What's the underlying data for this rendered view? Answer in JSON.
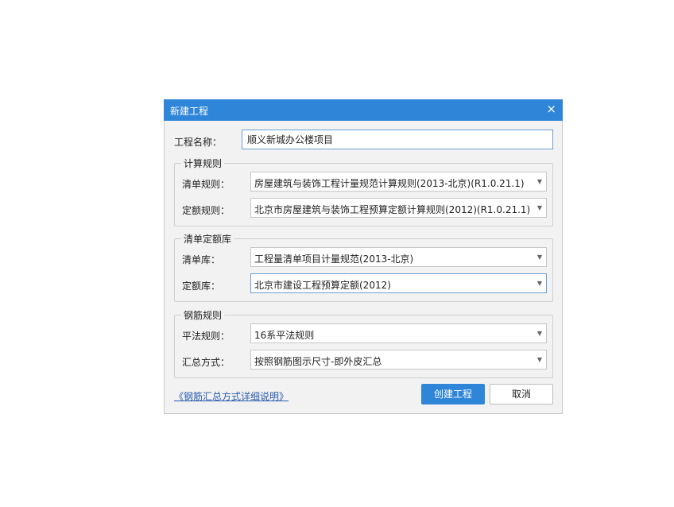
{
  "dialog": {
    "title": "新建工程",
    "close_icon": "×"
  },
  "project_name": {
    "label": "工程名称：",
    "value": "顺义新城办公楼项目"
  },
  "calc_rules": {
    "legend": "计算规则",
    "list_rule": {
      "label": "清单规则：",
      "value": "房屋建筑与装饰工程计量规范计算规则(2013-北京)(R1.0.21.1)"
    },
    "quota_rule": {
      "label": "定额规则：",
      "value": "北京市房屋建筑与装饰工程预算定额计算规则(2012)(R1.0.21.1)"
    }
  },
  "library": {
    "legend": "清单定额库",
    "list_lib": {
      "label": "清单库：",
      "value": "工程量清单项目计量规范(2013-北京)"
    },
    "quota_lib": {
      "label": "定额库：",
      "value": "北京市建设工程预算定额(2012)"
    }
  },
  "rebar": {
    "legend": "钢筋规则",
    "flat_rule": {
      "label": "平法规则：",
      "value": "16系平法规则"
    },
    "summary_mode": {
      "label": "汇总方式：",
      "value": "按照钢筋图示尺寸-即外皮汇总"
    }
  },
  "footer": {
    "help_link": "《钢筋汇总方式详细说明》",
    "create_button": "创建工程",
    "cancel_button": "取消"
  },
  "icons": {
    "dropdown": "chevron-down-icon",
    "close": "close-icon"
  },
  "colors": {
    "accent": "#2f86d9",
    "link": "#2a5db0"
  }
}
